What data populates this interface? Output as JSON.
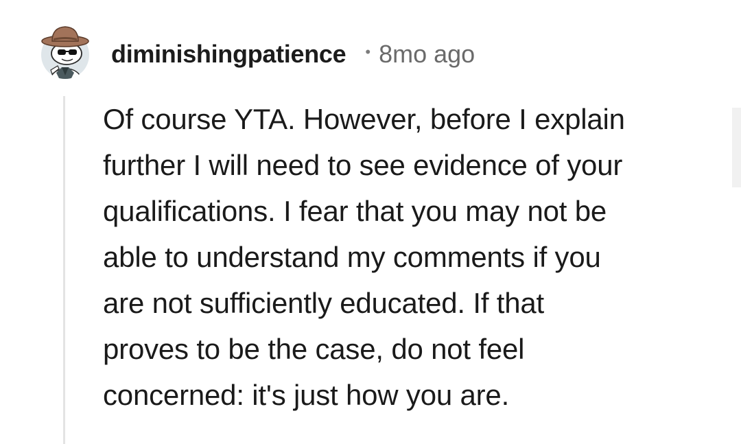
{
  "comment": {
    "username": "diminishingpatience",
    "separator": "•",
    "timestamp": "8mo ago",
    "body_lines": [
      "Of course YTA. However, before I explain",
      "further I will need to see evidence of your",
      "qualifications. I fear that you may not be",
      "able to understand my comments if you",
      "are not sufficiently educated. If that",
      "proves to be the case, do not feel",
      "concerned: it's just how you are."
    ],
    "avatar": {
      "icon": "snoo-avatar-cowboy-hat-sunglasses",
      "background": "#dfe6ea"
    }
  },
  "colors": {
    "username": "#1c1c1c",
    "timestamp": "#6a6a6a",
    "body_text": "#1a1a1a",
    "thread_line": "#e3e3e3"
  }
}
